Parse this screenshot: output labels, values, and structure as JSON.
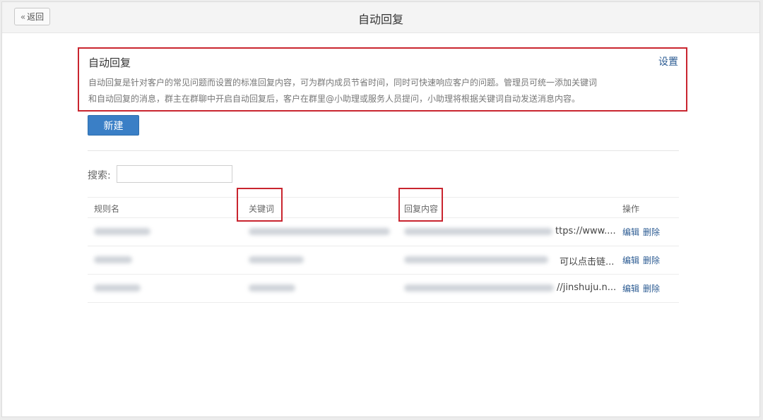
{
  "header": {
    "back_label": "返回",
    "title": "自动回复"
  },
  "intro": {
    "title": "自动回复",
    "settings_label": "设置",
    "line1": "自动回复是针对客户的常见问题而设置的标准回复内容，可为群内成员节省时间，同时可快速响应客户的问题。管理员可统一添加关键词",
    "line2": "和自动回复的消息，群主在群聊中开启自动回复后，客户在群里@小助理或服务人员提问，小助理将根据关键词自动发送消息内容。"
  },
  "toolbar": {
    "new_label": "新建"
  },
  "search": {
    "label": "搜索:",
    "value": "",
    "placeholder": ""
  },
  "table": {
    "columns": [
      "规则名",
      "关键词",
      "回复内容",
      "操作"
    ],
    "rows": [
      {
        "reply_tail": "ttps://www....",
        "edit": "编辑",
        "delete": "删除"
      },
      {
        "reply_tail": "可以点击链...",
        "edit": "编辑",
        "delete": "删除"
      },
      {
        "reply_tail": "//jinshuju.n...",
        "edit": "编辑",
        "delete": "删除"
      }
    ]
  },
  "colors": {
    "highlight": "#c9252f",
    "primary": "#3a7fc6",
    "link": "#2d5c93"
  }
}
